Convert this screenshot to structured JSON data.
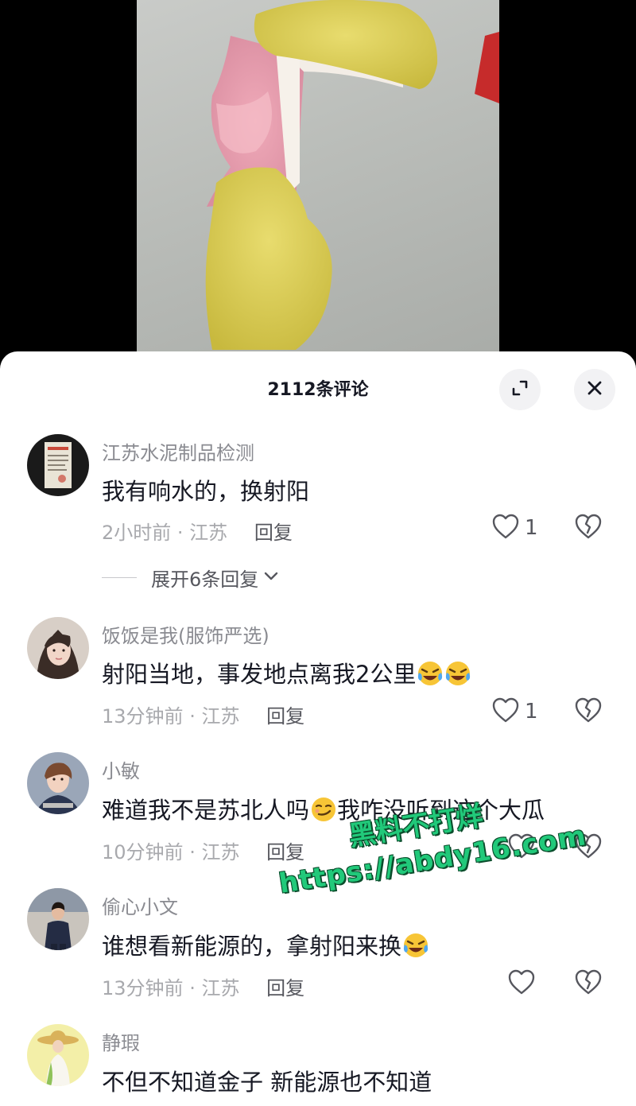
{
  "header": {
    "title": "2112条评论",
    "expand_icon": "expand-icon",
    "close_icon": "close-icon"
  },
  "comments": [
    {
      "username": "江苏水泥制品检测",
      "text": "我有响水的，换射阳",
      "time": "2小时前",
      "location": "江苏",
      "reply_label": "回复",
      "likes": "1",
      "expand_replies": "展开6条回复"
    },
    {
      "username": "饭饭是我(服饰严选)",
      "text": "射阳当地，事发地点离我2公里",
      "emojis": [
        "laugh-cry-emoji",
        "laugh-cry-emoji"
      ],
      "time": "13分钟前",
      "location": "江苏",
      "reply_label": "回复",
      "likes": "1"
    },
    {
      "username": "小敏",
      "text_before": "难道我不是苏北人吗",
      "text_after": "我咋没听到这个大瓜",
      "emojis": [
        "smirk-emoji"
      ],
      "time": "10分钟前",
      "location": "江苏",
      "reply_label": "回复"
    },
    {
      "username": "偷心小文",
      "text": "谁想看新能源的，拿射阳来换",
      "emojis": [
        "laugh-cry-emoji"
      ],
      "time": "13分钟前",
      "location": "江苏",
      "reply_label": "回复"
    },
    {
      "username": "静瑕",
      "text": "不但不知道金子 新能源也不知道"
    }
  ],
  "watermark": {
    "line1": "黑料不打烊",
    "line2": "https://abdy16.com"
  },
  "colors": {
    "accent_green": "#21c97a",
    "text_primary": "#161823",
    "text_secondary": "#8a8b91"
  }
}
